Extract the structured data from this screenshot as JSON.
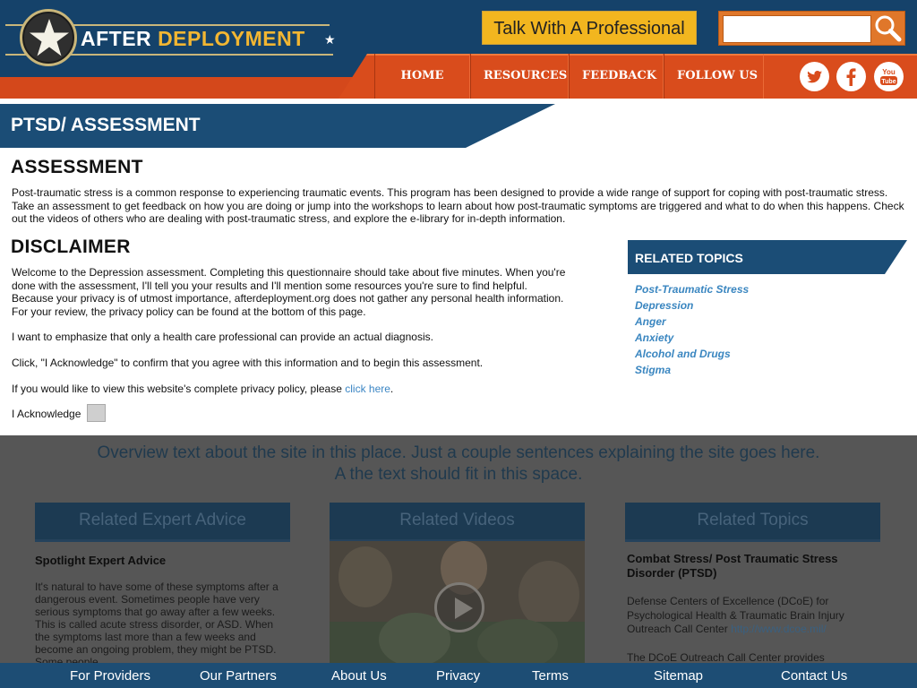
{
  "brand": {
    "after": "AFTER",
    "deployment": "DEPLOYMENT"
  },
  "header": {
    "talk_button": "Talk With A Professional",
    "search_value": "",
    "nav": [
      "HOME",
      "RESOURCES",
      "FEEDBACK",
      "FOLLOW US"
    ],
    "social_icons": [
      "twitter-icon",
      "facebook-icon",
      "youtube-icon"
    ]
  },
  "page": {
    "title": "PTSD/ ASSESSMENT"
  },
  "assessment": {
    "heading": "ASSESSMENT",
    "lines": [
      "Post-traumatic stress is a common response to experiencing traumatic events. This program has been designed to provide a wide range of support for coping with post-traumatic stress.",
      "Take an assessment to get feedback on how you are doing or jump into the workshops to learn about how post-traumatic symptoms are triggered and what to do when this happens. Check",
      "out the videos of others who are dealing with post-traumatic stress, and explore the e-library for in-depth information."
    ]
  },
  "disclaimer": {
    "heading": "DISCLAIMER",
    "p1_lines": [
      "Welcome to the Depression assessment. Completing this questionnaire should take about five minutes. When you're",
      "done with the assessment, I'll tell you your results and I'll mention some resources you're sure to find helpful.",
      "Because your privacy is of utmost importance, afterdeployment.org does not gather any personal health information.",
      "For your review, the privacy policy can be found at the bottom of this page."
    ],
    "p2": "I want to emphasize that only a health care professional can provide an actual diagnosis.",
    "p3": "Click, \"I Acknowledge\" to confirm that you agree with this information and to begin this assessment.",
    "p4_prefix": "If you would like to view this website's complete privacy policy, please ",
    "p4_link": "click here",
    "p4_suffix": ".",
    "acknowledge_label": "I Acknowledge"
  },
  "related_topics": {
    "heading": "RELATED TOPICS",
    "items": [
      "Post-Traumatic Stress",
      "Depression",
      "Anger",
      "Anxiety",
      "Alcohol and Drugs",
      "Stigma"
    ]
  },
  "overview": {
    "line1": "Overview text about the site in this place. Just a couple sentences explaining the site goes here.",
    "line2": "A the text should fit in this space."
  },
  "columns": {
    "expert": {
      "header": "Related Expert Advice",
      "title": "Spotlight Expert Advice",
      "lines": [
        "It's natural to have some of these symptoms after a",
        "dangerous event. Sometimes people have very",
        "serious symptoms that go away after a few weeks.",
        "This is called acute stress disorder, or ASD. When",
        "the symptoms last more than a few weeks and",
        "become an ongoing problem, they might be PTSD.",
        "Some people"
      ]
    },
    "videos": {
      "header": "Related Videos"
    },
    "topics": {
      "header": "Related Topics",
      "title_lines": [
        "Combat Stress/ Post Traumatic Stress",
        "Disorder (PTSD)"
      ],
      "lines": [
        "Defense Centers of Excellence (DCoE) for",
        "Psychological Health & Traumatic Brain Injury"
      ],
      "line3_prefix": "Outreach Call Center ",
      "line3_link": "http://www.dcoe.mil/",
      "line4": "The DCoE Outreach Call Center provides"
    }
  },
  "footer": {
    "links": [
      "For Providers",
      "Our Partners",
      "About Us",
      "Privacy",
      "Terms",
      "Sitemap",
      "Contact Us"
    ]
  }
}
